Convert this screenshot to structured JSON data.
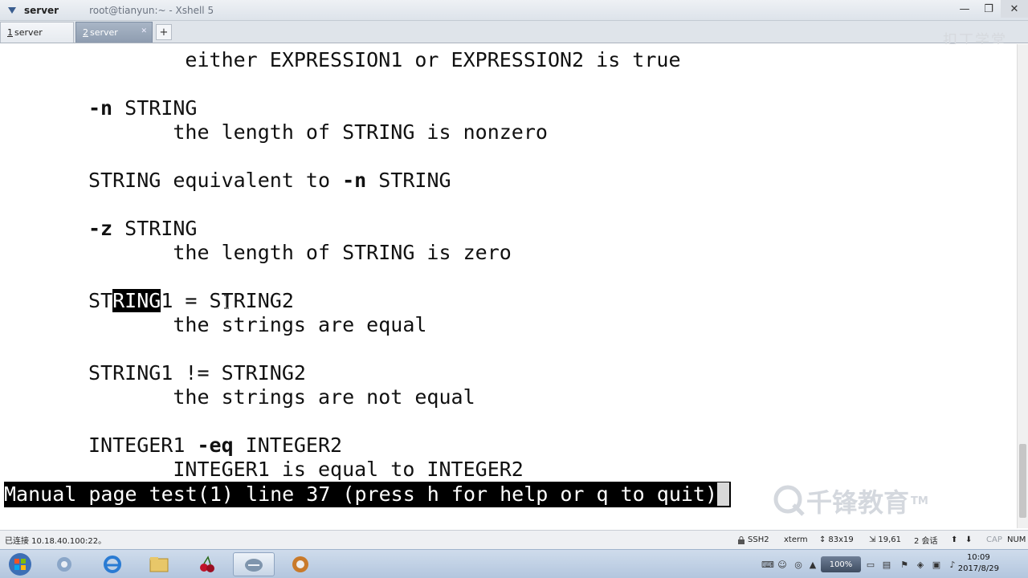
{
  "window": {
    "title": "server",
    "subtitle": "root@tianyun:~ - Xshell 5",
    "controls": {
      "minimize": "—",
      "maximize": "❐",
      "close": "✕"
    }
  },
  "tabs": [
    {
      "index": "1",
      "label": "server",
      "close": "✕"
    },
    {
      "index": "2",
      "label": "server",
      "close": "✕"
    }
  ],
  "tab_add": "+",
  "watermark": {
    "top": "扣丁学堂",
    "bottom": "千锋教育",
    "tm": "TM"
  },
  "terminal": {
    "lines": {
      "l0": "        either EXPRESSION1 or EXPRESSION2 is true",
      "l2_opt": "-n",
      "l2_rest": " STRING",
      "l3": "       the length of STRING is nonzero",
      "l5_a": "STRING equivalent to ",
      "l5_opt": "-n",
      "l5_b": " STRING",
      "l7_opt": "-z",
      "l7_rest": " STRING",
      "l8": "       the length of STRING is zero",
      "l10_a": "ST",
      "l10_sel": "RING",
      "l10_b": "1 = STRING2",
      "l11": "       the strings are equal",
      "l13": "STRING1 != STRING2",
      "l14": "       the strings are not equal",
      "l16_a": "INTEGER1 ",
      "l16_opt": "-eq",
      "l16_b": " INTEGER2",
      "l17": "       INTEGER1 is equal to INTEGER2"
    },
    "status_line": "Manual page test(1) line 37 (press h for help or q to quit)"
  },
  "statusbar": {
    "connection": "已连接 10.18.40.100:22。",
    "protocol": "SSH2",
    "terminal_type": "xterm",
    "size": "83x19",
    "position": "19,61",
    "sessions": "2 会话",
    "cap": "CAP",
    "num": "NUM"
  },
  "taskbar": {
    "battery": "100%",
    "time": "10:09",
    "date": "2017/8/29"
  }
}
